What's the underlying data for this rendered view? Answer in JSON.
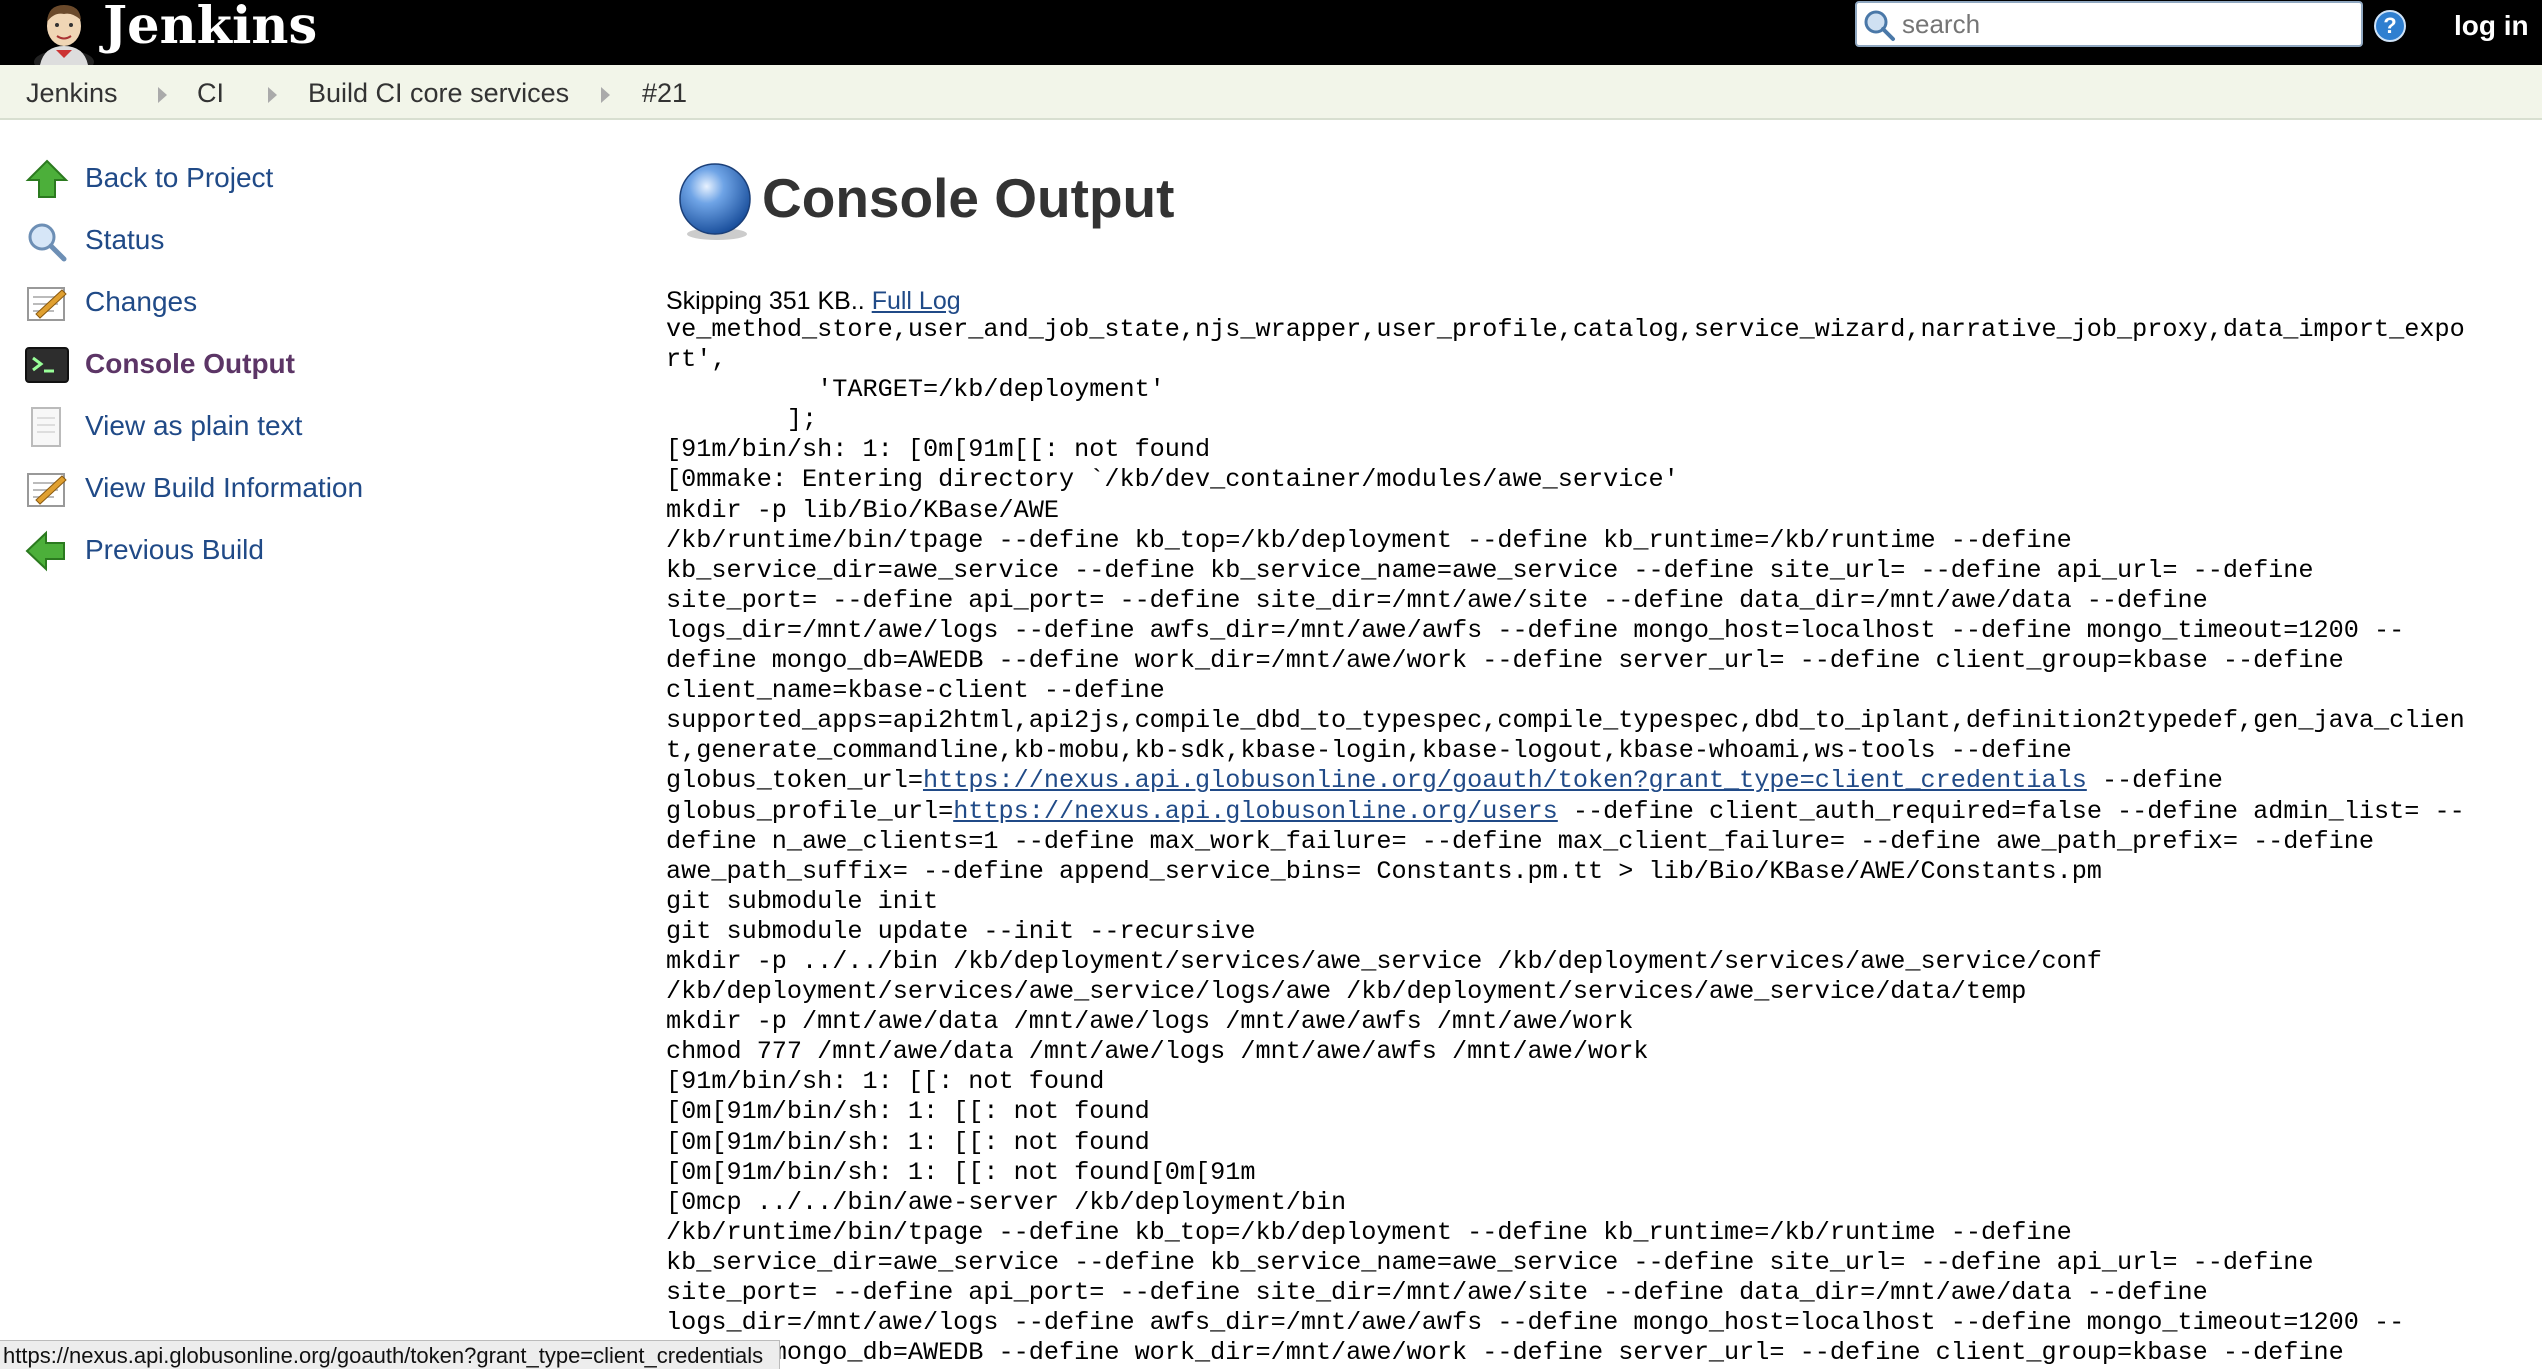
{
  "header": {
    "brand": "Jenkins",
    "search": {
      "placeholder": "search"
    },
    "help_label": "?",
    "login_label": "log in"
  },
  "breadcrumb": [
    "Jenkins",
    "CI",
    "Build CI core services",
    "#21"
  ],
  "sidebar": {
    "items": [
      {
        "label": "Back to Project",
        "icon": "up-arrow-icon"
      },
      {
        "label": "Status",
        "icon": "magnifier-icon"
      },
      {
        "label": "Changes",
        "icon": "notepad-icon"
      },
      {
        "label": "Console Output",
        "icon": "terminal-icon",
        "active": true
      },
      {
        "label": "View as plain text",
        "icon": "document-icon"
      },
      {
        "label": "View Build Information",
        "icon": "notepad-icon"
      },
      {
        "label": "Previous Build",
        "icon": "left-arrow-icon"
      }
    ]
  },
  "main": {
    "title": "Console Output",
    "skip_text": "Skipping 351 KB.. ",
    "full_log_label": "Full Log",
    "console": [
      "ve_method_store,user_and_job_state,njs_wrapper,user_profile,catalog,service_wizard,narrative_job_proxy,data_import_expo",
      "rt',",
      "          'TARGET=/kb/deployment'",
      "        ];",
      "[91m/bin/sh: 1: [0m[91m[[: not found",
      "[0mmake: Entering directory `/kb/dev_container/modules/awe_service'",
      "mkdir -p lib/Bio/KBase/AWE",
      "/kb/runtime/bin/tpage --define kb_top=/kb/deployment --define kb_runtime=/kb/runtime --define",
      "kb_service_dir=awe_service --define kb_service_name=awe_service --define site_url= --define api_url= --define",
      "site_port= --define api_port= --define site_dir=/mnt/awe/site --define data_dir=/mnt/awe/data --define",
      "logs_dir=/mnt/awe/logs --define awfs_dir=/mnt/awe/awfs --define mongo_host=localhost --define mongo_timeout=1200 --",
      "define mongo_db=AWEDB --define work_dir=/mnt/awe/work --define server_url= --define client_group=kbase --define",
      "client_name=kbase-client --define",
      "supported_apps=api2html,api2js,compile_dbd_to_typespec,compile_typespec,dbd_to_iplant,definition2typedef,gen_java_clien",
      "t,generate_commandline,kb-mobu,kb-sdk,kbase-login,kbase-logout,kbase-whoami,ws-tools --define",
      "globus_token_url=|https://nexus.api.globusonline.org/goauth/token?grant_type=client_credentials| --define",
      "globus_profile_url=|https://nexus.api.globusonline.org/users| --define client_auth_required=false --define admin_list= --",
      "define n_awe_clients=1 --define max_work_failure= --define max_client_failure= --define awe_path_prefix= --define",
      "awe_path_suffix= --define append_service_bins= Constants.pm.tt > lib/Bio/KBase/AWE/Constants.pm",
      "git submodule init",
      "git submodule update --init --recursive",
      "mkdir -p ../../bin /kb/deployment/services/awe_service /kb/deployment/services/awe_service/conf",
      "/kb/deployment/services/awe_service/logs/awe /kb/deployment/services/awe_service/data/temp",
      "mkdir -p /mnt/awe/data /mnt/awe/logs /mnt/awe/awfs /mnt/awe/work",
      "chmod 777 /mnt/awe/data /mnt/awe/logs /mnt/awe/awfs /mnt/awe/work",
      "[91m/bin/sh: 1: [[: not found",
      "[0m[91m/bin/sh: 1: [[: not found",
      "[0m[91m/bin/sh: 1: [[: not found",
      "[0m[91m/bin/sh: 1: [[: not found[0m[91m",
      "[0mcp ../../bin/awe-server /kb/deployment/bin",
      "/kb/runtime/bin/tpage --define kb_top=/kb/deployment --define kb_runtime=/kb/runtime --define",
      "kb_service_dir=awe_service --define kb_service_name=awe_service --define site_url= --define api_url= --define",
      "site_port= --define api_port= --define site_dir=/mnt/awe/site --define data_dir=/mnt/awe/data --define",
      "logs_dir=/mnt/awe/logs --define awfs_dir=/mnt/awe/awfs --define mongo_host=localhost --define mongo_timeout=1200 --",
      "define mongo_db=AWEDB --define work_dir=/mnt/awe/work --define server_url= --define client_group=kbase --define"
    ]
  },
  "status_bar": "https://nexus.api.globusonline.org/goauth/token?grant_type=client_credentials",
  "colors": {
    "header_bg": "#000000",
    "breadcrumb_bg": "#f2f5e9",
    "link": "#204a87",
    "active_task": "#5c3566"
  }
}
